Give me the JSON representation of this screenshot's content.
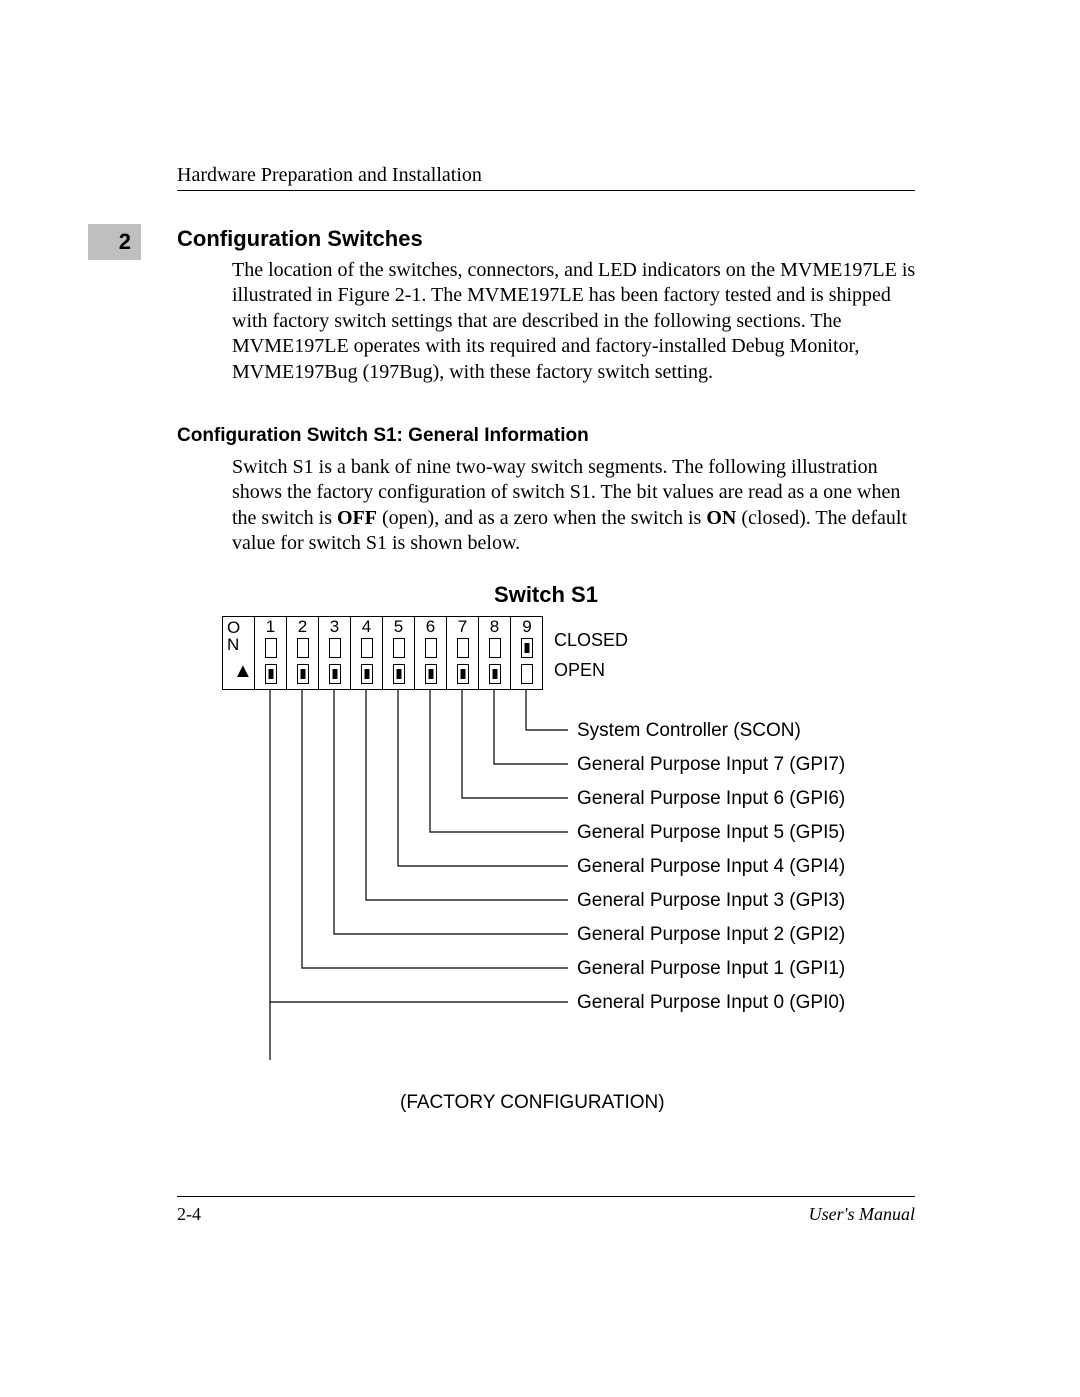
{
  "header": {
    "running": "Hardware Preparation and Installation",
    "chapter": "2"
  },
  "section": {
    "title": "Configuration Switches",
    "para1": "The location of the switches, connectors, and LED indicators on the MVME197LE is illustrated in Figure 2-1. The MVME197LE has been factory tested and is shipped with factory switch settings that are described in the following sections. The MVME197LE operates with its required and factory-installed Debug Monitor, MVME197Bug (197Bug), with these factory switch setting."
  },
  "subsection": {
    "title": "Configuration Switch S1: General Information",
    "para_a": "Switch S1 is a bank of nine two-way switch segments. The following illustration shows the factory configuration of switch S1. The bit values are read as a one when the switch is ",
    "off": "OFF",
    "para_b": " (open), and as a zero when the switch is ",
    "on": "ON",
    "para_c": " (closed). The default value for switch S1 is shown below."
  },
  "figure": {
    "title": "Switch S1",
    "on_col_line1": "O",
    "on_col_line2": "N",
    "closed": "CLOSED",
    "open": "OPEN",
    "switch_numbers": [
      "1",
      "2",
      "3",
      "4",
      "5",
      "6",
      "7",
      "8",
      "9"
    ],
    "switch_positions": [
      "open",
      "open",
      "open",
      "open",
      "open",
      "open",
      "open",
      "open",
      "closed"
    ],
    "labels": [
      "System Controller (SCON)",
      "General Purpose Input 7 (GPI7)",
      "General Purpose Input 6 (GPI6)",
      "General Purpose Input 5 (GPI5)",
      "General Purpose Input 4 (GPI4)",
      "General Purpose Input 3 (GPI3)",
      "General Purpose Input 2 (GPI2)",
      "General Purpose Input 1 (GPI1)",
      "General Purpose Input 0 (GPI0)"
    ],
    "factory": "(FACTORY CONFIGURATION)"
  },
  "footer": {
    "page": "2-4",
    "manual": "User's Manual"
  }
}
